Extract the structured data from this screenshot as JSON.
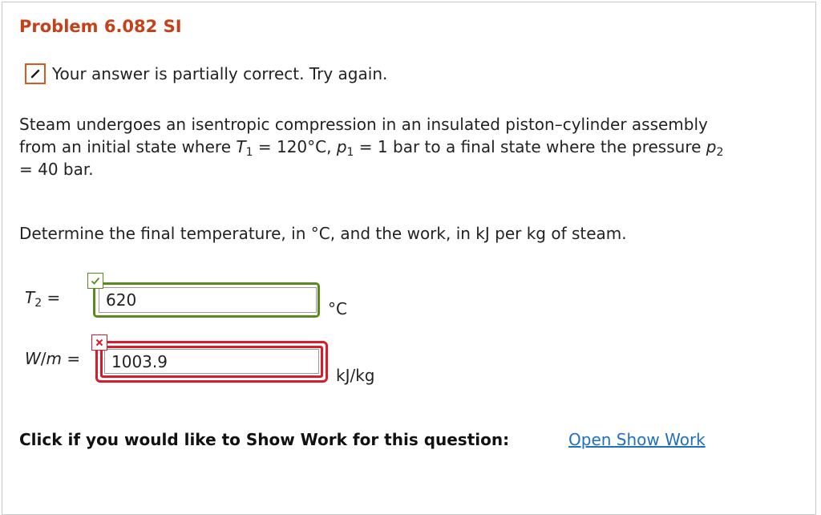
{
  "problem": {
    "title": "Problem 6.082 SI"
  },
  "status": {
    "icon": "pencil-icon",
    "text": "Your answer is partially correct.  Try again.",
    "accent_color": "#d95a1e"
  },
  "statement": {
    "line1": "Steam undergoes an isentropic compression in an insulated piston–cylinder assembly",
    "line2_prefix": "from an initial state where ",
    "t1_var": "T",
    "t1_sub": "1",
    "t1_value": " = 120°C, ",
    "p1_var": "p",
    "p1_sub": "1",
    "p1_value": " = 1 bar to a final state where the pressure ",
    "p2_var": "p",
    "p2_sub": "2",
    "line3": "= 40 bar."
  },
  "question": "Determine the final temperature, in °C, and the work, in kJ per kg of steam.",
  "answers": {
    "temperature": {
      "var": "T",
      "sub": "2",
      "eq": " =",
      "value": "620",
      "unit": "°C",
      "status_icon": "check-icon",
      "status_color": "#5a8a1e"
    },
    "work": {
      "var": "W",
      "slash_var": "m",
      "eq": " =",
      "value": "1003.9",
      "unit": "kJ/kg",
      "status_icon": "cross-icon",
      "status_color": "#d91b2a"
    }
  },
  "footer": {
    "label": "Click if you would like to Show Work for this question:",
    "link": "Open Show Work",
    "link_color": "#1f70c1"
  }
}
